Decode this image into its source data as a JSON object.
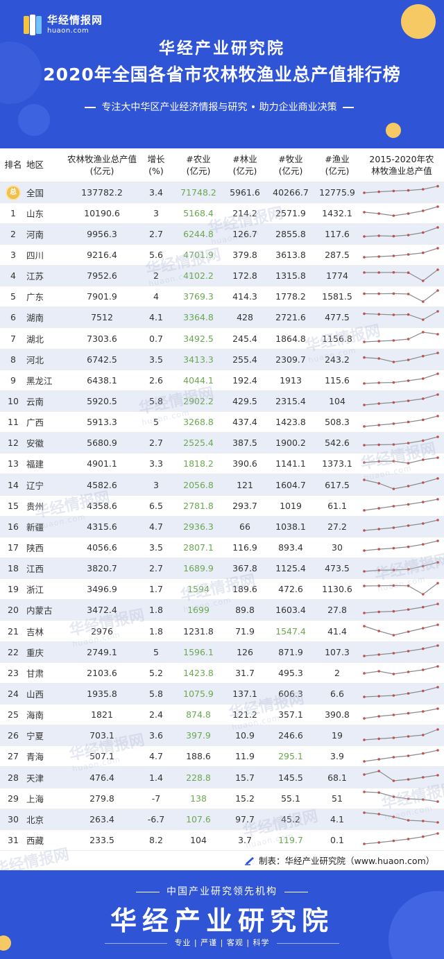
{
  "header": {
    "logo_cn": "华经情报网",
    "logo_en": "huaon.com",
    "org_title": "华经产业研究院",
    "main_title": "2020年全国各省市农林牧渔业总产值排行榜",
    "subtitle": "专注大中华区产业经济情报与研究 • 助力企业商业决策"
  },
  "colors": {
    "header_bg": "#2f54d6",
    "accent_yellow": "#f6c965",
    "highlight_green": "#6aa84f",
    "row_alt": "#e9edf7"
  },
  "table": {
    "columns": [
      "排名",
      "地区",
      "农林牧渔业总产值\n(亿元)",
      "增长\n(%)",
      "#农业\n(亿元)",
      "#林业\n(亿元)",
      "#牧业\n(亿元)",
      "#渔业\n(亿元)",
      "2015-2020年农\n林牧渔业总产值"
    ],
    "national_badge": "总",
    "rows": [
      {
        "rank": "",
        "region": "全国",
        "total": "137782.2",
        "growth": "3.4",
        "agri": "71748.2",
        "forest": "5961.6",
        "animal": "40266.7",
        "fish": "12775.9",
        "hl": "agri",
        "spark": [
          0.45,
          0.52,
          0.58,
          0.62,
          0.7,
          0.92
        ]
      },
      {
        "rank": "1",
        "region": "山东",
        "total": "10190.6",
        "growth": "3",
        "agri": "5168.4",
        "forest": "214.2",
        "animal": "2571.9",
        "fish": "1432.1",
        "hl": "agri",
        "spark": [
          0.55,
          0.45,
          0.3,
          0.45,
          0.65,
          0.95
        ]
      },
      {
        "rank": "2",
        "region": "河南",
        "total": "9956.3",
        "growth": "2.7",
        "agri": "6244.8",
        "forest": "126.7",
        "animal": "2855.8",
        "fish": "117.6",
        "hl": "agri",
        "spark": [
          0.3,
          0.35,
          0.32,
          0.4,
          0.58,
          0.95
        ]
      },
      {
        "rank": "3",
        "region": "四川",
        "total": "9216.4",
        "growth": "5.6",
        "agri": "4701.9",
        "forest": "379.8",
        "animal": "3613.8",
        "fish": "287.5",
        "hl": "agri",
        "spark": [
          0.3,
          0.35,
          0.4,
          0.5,
          0.62,
          0.95
        ]
      },
      {
        "rank": "4",
        "region": "江苏",
        "total": "7952.6",
        "growth": "2",
        "agri": "4102.2",
        "forest": "172.8",
        "animal": "1315.8",
        "fish": "1774",
        "hl": "agri",
        "spark": [
          0.75,
          0.75,
          0.76,
          0.74,
          0.15,
          0.95
        ]
      },
      {
        "rank": "5",
        "region": "广东",
        "total": "7901.9",
        "growth": "4",
        "agri": "3769.3",
        "forest": "414.3",
        "animal": "1778.2",
        "fish": "1581.5",
        "hl": "agri",
        "spark": [
          0.72,
          0.72,
          0.73,
          0.7,
          0.15,
          0.95
        ]
      },
      {
        "rank": "6",
        "region": "湖南",
        "total": "7512",
        "growth": "4.1",
        "agri": "3364.8",
        "forest": "428",
        "animal": "2721.6",
        "fish": "477.5",
        "hl": "agri",
        "spark": [
          0.78,
          0.74,
          0.7,
          0.72,
          0.35,
          0.95
        ]
      },
      {
        "rank": "7",
        "region": "湖北",
        "total": "7303.6",
        "growth": "0.7",
        "agri": "3492.5",
        "forest": "245.4",
        "animal": "1864.8",
        "fish": "1156.8",
        "hl": "agri",
        "spark": [
          0.25,
          0.3,
          0.35,
          0.45,
          0.95,
          0.8
        ]
      },
      {
        "rank": "8",
        "region": "河北",
        "total": "6742.5",
        "growth": "3.5",
        "agri": "3413.3",
        "forest": "255.4",
        "animal": "2309.7",
        "fish": "243.2",
        "hl": "agri",
        "spark": [
          0.62,
          0.55,
          0.3,
          0.45,
          0.72,
          0.95
        ]
      },
      {
        "rank": "9",
        "region": "黑龙江",
        "total": "6438.1",
        "growth": "2.6",
        "agri": "4044.1",
        "forest": "192.4",
        "animal": "1913",
        "fish": "115.6",
        "hl": "agri",
        "spark": [
          0.25,
          0.3,
          0.32,
          0.45,
          0.6,
          0.95
        ]
      },
      {
        "rank": "10",
        "region": "云南",
        "total": "5920.5",
        "growth": "5.8",
        "agri": "2902.2",
        "forest": "429.5",
        "animal": "2315.4",
        "fish": "104",
        "hl": "agri",
        "spark": [
          0.2,
          0.3,
          0.38,
          0.5,
          0.65,
          0.95
        ]
      },
      {
        "rank": "11",
        "region": "广西",
        "total": "5913.3",
        "growth": "5",
        "agri": "3268.8",
        "forest": "437.4",
        "animal": "1423.8",
        "fish": "508.3",
        "hl": "agri",
        "spark": [
          0.2,
          0.3,
          0.4,
          0.52,
          0.68,
          0.95
        ]
      },
      {
        "rank": "12",
        "region": "安徽",
        "total": "5680.9",
        "growth": "2.7",
        "agri": "2525.4",
        "forest": "387.5",
        "animal": "1900.2",
        "fish": "542.6",
        "hl": "agri",
        "spark": [
          0.35,
          0.38,
          0.4,
          0.5,
          0.68,
          0.95
        ]
      },
      {
        "rank": "13",
        "region": "福建",
        "total": "4901.1",
        "growth": "3.3",
        "agri": "1818.2",
        "forest": "390.6",
        "animal": "1141.1",
        "fish": "1373.1",
        "hl": "agri",
        "spark": [
          0.6,
          0.68,
          0.7,
          0.55,
          0.8,
          0.95
        ]
      },
      {
        "rank": "14",
        "region": "辽宁",
        "total": "4582.6",
        "growth": "3",
        "agri": "2056.8",
        "forest": "121",
        "animal": "1604.7",
        "fish": "617.5",
        "hl": "agri",
        "spark": [
          0.85,
          0.6,
          0.2,
          0.4,
          0.65,
          0.95
        ]
      },
      {
        "rank": "15",
        "region": "贵州",
        "total": "4358.6",
        "growth": "6.5",
        "agri": "2781.8",
        "forest": "293.7",
        "animal": "1019",
        "fish": "61.1",
        "hl": "agri",
        "spark": [
          0.15,
          0.3,
          0.45,
          0.58,
          0.75,
          0.95
        ]
      },
      {
        "rank": "16",
        "region": "新疆",
        "total": "4315.6",
        "growth": "4.7",
        "agri": "2936.3",
        "forest": "66",
        "animal": "1038.1",
        "fish": "27.2",
        "hl": "agri",
        "spark": [
          0.2,
          0.3,
          0.4,
          0.55,
          0.7,
          0.95
        ]
      },
      {
        "rank": "17",
        "region": "陕西",
        "total": "4056.6",
        "growth": "3.5",
        "agri": "2807.1",
        "forest": "116.9",
        "animal": "893.4",
        "fish": "30",
        "hl": "agri",
        "spark": [
          0.25,
          0.35,
          0.42,
          0.52,
          0.7,
          0.95
        ]
      },
      {
        "rank": "18",
        "region": "江西",
        "total": "3820.7",
        "growth": "2.7",
        "agri": "1689.9",
        "forest": "367.8",
        "animal": "1125.4",
        "fish": "473.5",
        "hl": "agri",
        "spark": [
          0.3,
          0.38,
          0.4,
          0.45,
          0.68,
          0.95
        ]
      },
      {
        "rank": "19",
        "region": "浙江",
        "total": "3496.9",
        "growth": "1.7",
        "agri": "1594",
        "forest": "189.6",
        "animal": "472.6",
        "fish": "1130.6",
        "hl": "agri",
        "spark": [
          0.75,
          0.76,
          0.78,
          0.76,
          0.15,
          0.95
        ]
      },
      {
        "rank": "20",
        "region": "内蒙古",
        "total": "3472.4",
        "growth": "1.8",
        "agri": "1699",
        "forest": "89.8",
        "animal": "1603.4",
        "fish": "27.8",
        "hl": "agri",
        "spark": [
          0.3,
          0.38,
          0.42,
          0.55,
          0.72,
          0.95
        ]
      },
      {
        "rank": "21",
        "region": "吉林",
        "total": "2976",
        "growth": "1.8",
        "agri": "1231.8",
        "forest": "71.9",
        "animal": "1547.4",
        "fish": "41.4",
        "hl": "animal",
        "spark": [
          0.85,
          0.5,
          0.2,
          0.45,
          0.7,
          0.95
        ]
      },
      {
        "rank": "22",
        "region": "重庆",
        "total": "2749.1",
        "growth": "5",
        "agri": "1596.1",
        "forest": "126",
        "animal": "871.9",
        "fish": "107.3",
        "hl": "agri",
        "spark": [
          0.2,
          0.3,
          0.4,
          0.55,
          0.72,
          0.95
        ]
      },
      {
        "rank": "23",
        "region": "甘肃",
        "total": "2103.6",
        "growth": "5.2",
        "agri": "1423.8",
        "forest": "31.7",
        "animal": "495.3",
        "fish": "2",
        "hl": "agri",
        "spark": [
          0.45,
          0.6,
          0.4,
          0.55,
          0.7,
          0.95
        ]
      },
      {
        "rank": "24",
        "region": "山西",
        "total": "1935.8",
        "growth": "5.8",
        "agri": "1075.9",
        "forest": "137.1",
        "animal": "606.3",
        "fish": "6.6",
        "hl": "agri",
        "spark": [
          0.25,
          0.3,
          0.35,
          0.5,
          0.68,
          0.95
        ]
      },
      {
        "rank": "25",
        "region": "海南",
        "total": "1821",
        "growth": "2.4",
        "agri": "874.8",
        "forest": "121.2",
        "animal": "357.1",
        "fish": "390.8",
        "hl": "agri",
        "spark": [
          0.25,
          0.4,
          0.5,
          0.62,
          0.75,
          0.95
        ]
      },
      {
        "rank": "26",
        "region": "宁夏",
        "total": "703.1",
        "growth": "3.6",
        "agri": "397.9",
        "forest": "10.9",
        "animal": "246.6",
        "fish": "19",
        "hl": "agri",
        "spark": [
          0.2,
          0.28,
          0.35,
          0.45,
          0.55,
          0.95
        ]
      },
      {
        "rank": "27",
        "region": "青海",
        "total": "507.1",
        "growth": "4.7",
        "agri": "188.6",
        "forest": "11.9",
        "animal": "295.1",
        "fish": "3.9",
        "hl": "animal",
        "spark": [
          0.15,
          0.3,
          0.45,
          0.55,
          0.72,
          0.95
        ]
      },
      {
        "rank": "28",
        "region": "天津",
        "total": "476.4",
        "growth": "1.4",
        "agri": "228.8",
        "forest": "15.7",
        "animal": "145.5",
        "fish": "68.1",
        "hl": "agri",
        "spark": [
          0.7,
          0.95,
          0.25,
          0.35,
          0.5,
          0.65
        ]
      },
      {
        "rank": "29",
        "region": "上海",
        "total": "279.8",
        "growth": "-7",
        "agri": "138",
        "forest": "15.2",
        "animal": "55.1",
        "fish": "51",
        "hl": "agri",
        "spark": [
          0.95,
          0.9,
          0.6,
          0.45,
          0.4,
          0.25
        ]
      },
      {
        "rank": "30",
        "region": "北京",
        "total": "263.4",
        "growth": "-6.7",
        "agri": "107.6",
        "forest": "97.7",
        "animal": "45.2",
        "fish": "4.1",
        "hl": "agri",
        "spark": [
          0.95,
          0.85,
          0.65,
          0.4,
          0.35,
          0.25
        ]
      },
      {
        "rank": "31",
        "region": "西藏",
        "total": "233.5",
        "growth": "8.2",
        "agri": "104",
        "forest": "3.7",
        "animal": "119.7",
        "fish": "0.1",
        "hl": "animal",
        "spark": [
          0.2,
          0.3,
          0.42,
          0.55,
          0.72,
          0.95
        ]
      }
    ]
  },
  "maker": "制表：华经产业研究院（www.huaon.com）",
  "footer": {
    "tagline": "中国产业研究领先机构",
    "name": "华经产业研究院",
    "words": "专业 | 严谨 | 客观 | 科学"
  },
  "watermark": {
    "cn": "华经情报网",
    "en": "huaon.com"
  }
}
